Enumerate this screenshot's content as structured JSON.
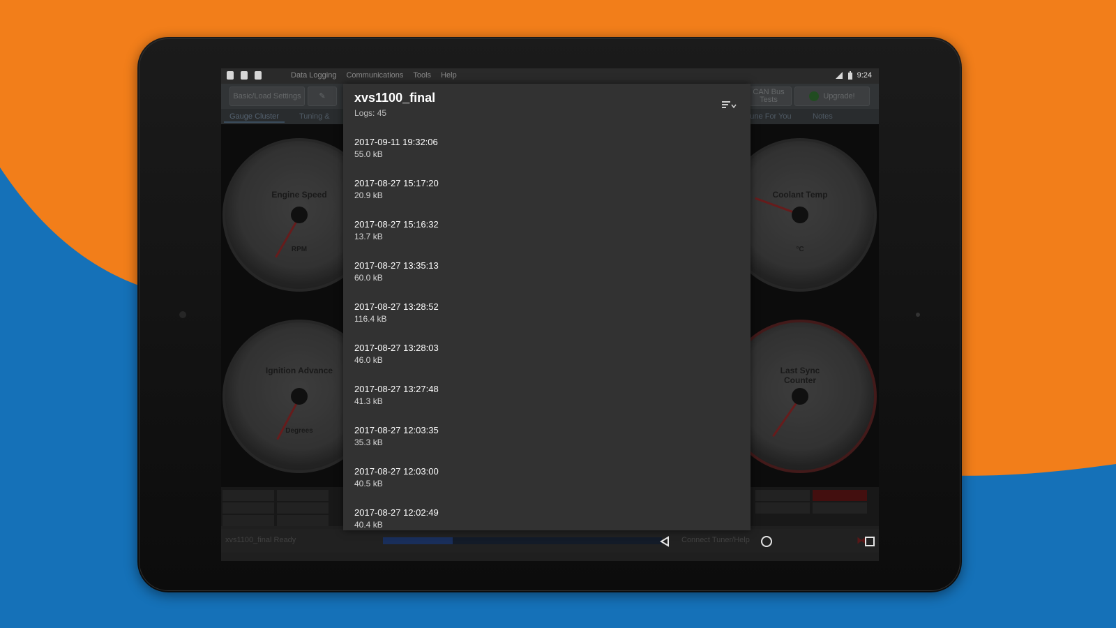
{
  "colors": {
    "orange": "#f27e1a",
    "blue": "#1571b8",
    "dialog_bg": "#323232"
  },
  "statusbar": {
    "menu": [
      "Data Logging",
      "Communications",
      "Tools",
      "Help"
    ],
    "time": "9:24"
  },
  "toolbar": {
    "buttons": [
      {
        "label": "Basic/Load Settings"
      },
      {
        "label": "CAN Bus Tests"
      },
      {
        "label": "Upgrade!"
      }
    ]
  },
  "tabs": [
    "Gauge Cluster",
    "Tuning &",
    "Tune For You",
    "Notes"
  ],
  "gauges": [
    {
      "label": "Engine Speed",
      "unit": "RPM"
    },
    {
      "label": "Coolant Temp",
      "unit": "°C"
    },
    {
      "label": "Ignition Advance",
      "unit": "Degrees"
    },
    {
      "label": "Last Sync Counter",
      "unit": ""
    }
  ],
  "status": {
    "text": "xvs1100_final Ready",
    "right_text": "Connect Tuner/Help"
  },
  "dialog": {
    "title": "xvs1100_final",
    "subtitle": "Logs: 45",
    "logs": [
      {
        "date": "2017-09-11 19:32:06",
        "size": "55.0 kB"
      },
      {
        "date": "2017-08-27 15:17:20",
        "size": "20.9 kB"
      },
      {
        "date": "2017-08-27 15:16:32",
        "size": "13.7 kB"
      },
      {
        "date": "2017-08-27 13:35:13",
        "size": "60.0 kB"
      },
      {
        "date": "2017-08-27 13:28:52",
        "size": "116.4 kB"
      },
      {
        "date": "2017-08-27 13:28:03",
        "size": "46.0 kB"
      },
      {
        "date": "2017-08-27 13:27:48",
        "size": "41.3 kB"
      },
      {
        "date": "2017-08-27 12:03:35",
        "size": "35.3 kB"
      },
      {
        "date": "2017-08-27 12:03:00",
        "size": "40.5 kB"
      },
      {
        "date": "2017-08-27 12:02:49",
        "size": "40.4 kB"
      }
    ]
  },
  "navbar": {
    "icons": [
      "back-icon",
      "home-icon",
      "recents-icon"
    ]
  }
}
